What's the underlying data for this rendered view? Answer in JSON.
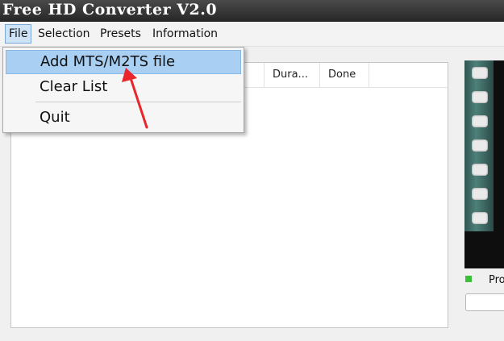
{
  "window": {
    "title": "Free HD Converter V2.0"
  },
  "menubar": {
    "items": [
      {
        "label": "File"
      },
      {
        "label": "Selection"
      },
      {
        "label": "Presets"
      },
      {
        "label": "Information"
      }
    ]
  },
  "file_menu": {
    "items": [
      {
        "label": "Add MTS/M2TS file",
        "highlighted": true
      },
      {
        "label": "Clear List"
      },
      {
        "label": "Quit"
      }
    ]
  },
  "file_list": {
    "columns": [
      {
        "label": "Dura..."
      },
      {
        "label": "Done"
      }
    ]
  },
  "status": {
    "indicator_color": "#3bc03b",
    "label": "Pro"
  },
  "annotation": {
    "arrow_color": "#e8262b"
  }
}
